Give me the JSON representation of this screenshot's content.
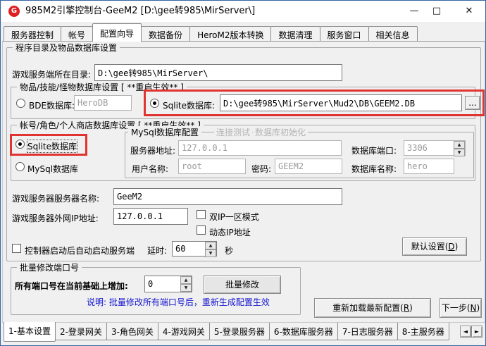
{
  "window": {
    "title": "985M2引擎控制台-GeeM2 [D:\\gee转985\\MirServer\\]",
    "icon_letter": "G",
    "minimize": "—",
    "maximize": "□",
    "close": "✕"
  },
  "top_tabs": [
    "服务器控制",
    "帐号",
    "配置向导",
    "数据备份",
    "HeroM2版本转换",
    "数据清理",
    "服务窗口",
    "相关信息"
  ],
  "top_tabs_active": "配置向导",
  "main_group": {
    "title": "程序目录及物品数据库设置",
    "dir_label": "游戏服务端所在目录:",
    "dir_value": "D:\\gee转985\\MirServer\\",
    "item_group": {
      "title": "物品/技能/怪物数据库设置 [ **重启生效** ]",
      "bde_label": "BDE数据库:",
      "bde_value": "HeroDB",
      "sqlite_label": "Sqlite数据库:",
      "sqlite_value": "D:\\gee转985\\MirServer\\Mud2\\DB\\GEEM2.DB",
      "browse_label": "..."
    },
    "account_group": {
      "title": "帐号/角色/个人商店数据库设置 [ **重启生效** ]",
      "sqlite_radio": "Sqlite数据库",
      "mysql_radio": "MySql数据库",
      "mysql_group": {
        "title": "MySql数据库配置",
        "test_link": "连接测试",
        "init_link": "数据库初始化",
        "host_label": "服务器地址:",
        "host_value": "127.0.0.1",
        "port_label": "数据库端口:",
        "port_value": "3306",
        "user_label": "用户名称:",
        "user_value": "root",
        "pass_label": "密码:",
        "pass_value": "GEEM2",
        "dbname_label": "数据库名称:",
        "dbname_value": "hero"
      }
    },
    "server_name_label": "游戏服务器服务器名称:",
    "server_name_value": "GeeM2",
    "ip_label": "游戏服务器外网IP地址:",
    "ip_value": "127.0.0.1",
    "dual_ip_label": "双IP一区模式",
    "dynamic_ip_label": "动态IP地址",
    "autostart_label": "控制器启动后自动启动服务端",
    "delay_label": "延时:",
    "delay_value": "60",
    "seconds_label": "秒",
    "default_btn": {
      "pre": "默认设置(",
      "key": "D",
      "post": ")"
    }
  },
  "batch_group": {
    "title": "批量修改端口号",
    "inc_label": "所有端口号在当前基础上增加:",
    "inc_value": "0",
    "batch_btn": "批量修改",
    "note": "说明: 批量修改所有端口号后，重新生成配置生效"
  },
  "reload_btn": {
    "pre": "重新加载最新配置(",
    "key": "R",
    "post": ")"
  },
  "next_btn": {
    "pre": "下一步(",
    "key": "N",
    "post": ")"
  },
  "bottom_tabs": [
    "1-基本设置",
    "2-登录网关",
    "3-角色网关",
    "4-游戏网关",
    "5-登录服务器",
    "6-数据库服务器",
    "7-日志服务器",
    "8-主服务器"
  ],
  "bottom_tabs_active": "1-基本设置",
  "tab_scroll": {
    "left": "◄",
    "right": "►"
  },
  "colors": {
    "highlight": "#e03430",
    "note_blue": "#1515d0",
    "titlebar": "#ffffff",
    "bg": "#f0f0f0"
  }
}
